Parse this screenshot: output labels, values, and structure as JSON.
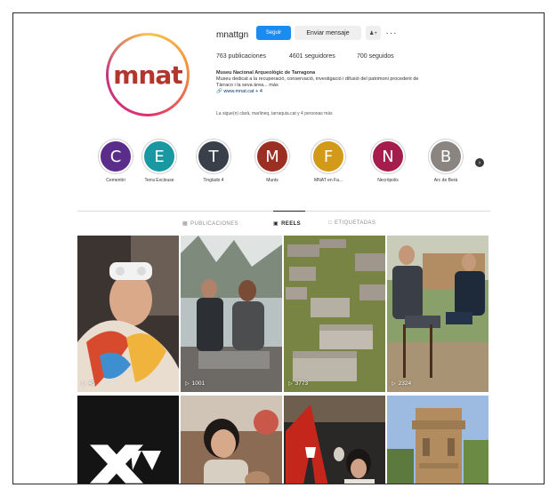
{
  "profile": {
    "username": "mnattgn",
    "avatar_text": "mnat",
    "follow_label": "Seguir",
    "message_label": "Enviar mensaje",
    "suggest_icon": "person-add-icon",
    "more_icon": "more-icon",
    "stats": {
      "posts": "763 publicaciones",
      "followers": "4601 seguidores",
      "following": "700 seguidos"
    },
    "bio": {
      "name": "Museu Nacional Arqueològic de Tarragona",
      "line1": "Museu dedicat a la recuperació, conservació, investigació i difusió del patrimoni procedent de",
      "line2": "Tàrraco i la seva àrea... más",
      "link": "www.mnat.cat + 4"
    },
    "followed_by": "La sigue(n) clarà, marlineq, tarraquia.cat y 4 personas más"
  },
  "highlights": [
    {
      "letter": "C",
      "label": "Cementiri",
      "color": "#5b2d8a"
    },
    {
      "letter": "E",
      "label": "Terra Exclouse",
      "color": "#1a98a2"
    },
    {
      "letter": "T",
      "label": "Tinglado 4",
      "color": "#394049"
    },
    {
      "letter": "M",
      "label": "Munts",
      "color": "#9c2f23"
    },
    {
      "letter": "F",
      "label": "MNAT en Fa...",
      "color": "#d39a1a"
    },
    {
      "letter": "N",
      "label": "Necròpolis",
      "color": "#a51d4c"
    },
    {
      "letter": "B",
      "label": "Arc de Berà",
      "color": "#8a8580"
    }
  ],
  "tabs": [
    {
      "label": "PUBLICACIONES",
      "icon": "grid-icon",
      "active": false
    },
    {
      "label": "REELS",
      "icon": "reels-icon",
      "active": true
    },
    {
      "label": "ETIQUETADAS",
      "icon": "tagged-icon",
      "active": false
    }
  ],
  "reels": [
    {
      "views": "45",
      "subject": "child-vr-headset"
    },
    {
      "views": "1001",
      "subject": "people-at-monument"
    },
    {
      "views": "3773",
      "subject": "sarcophagi-in-grass"
    },
    {
      "views": "2324",
      "subject": "outdoor-interview"
    },
    {
      "views": "",
      "subject": "tarraco-logo"
    },
    {
      "views": "",
      "subject": "child-with-artifact"
    },
    {
      "views": "",
      "subject": "museum-exhibit"
    },
    {
      "views": "",
      "subject": "roman-tower"
    }
  ],
  "colors": {
    "accent": "#1a8cf0",
    "logo": "#b1362c"
  }
}
